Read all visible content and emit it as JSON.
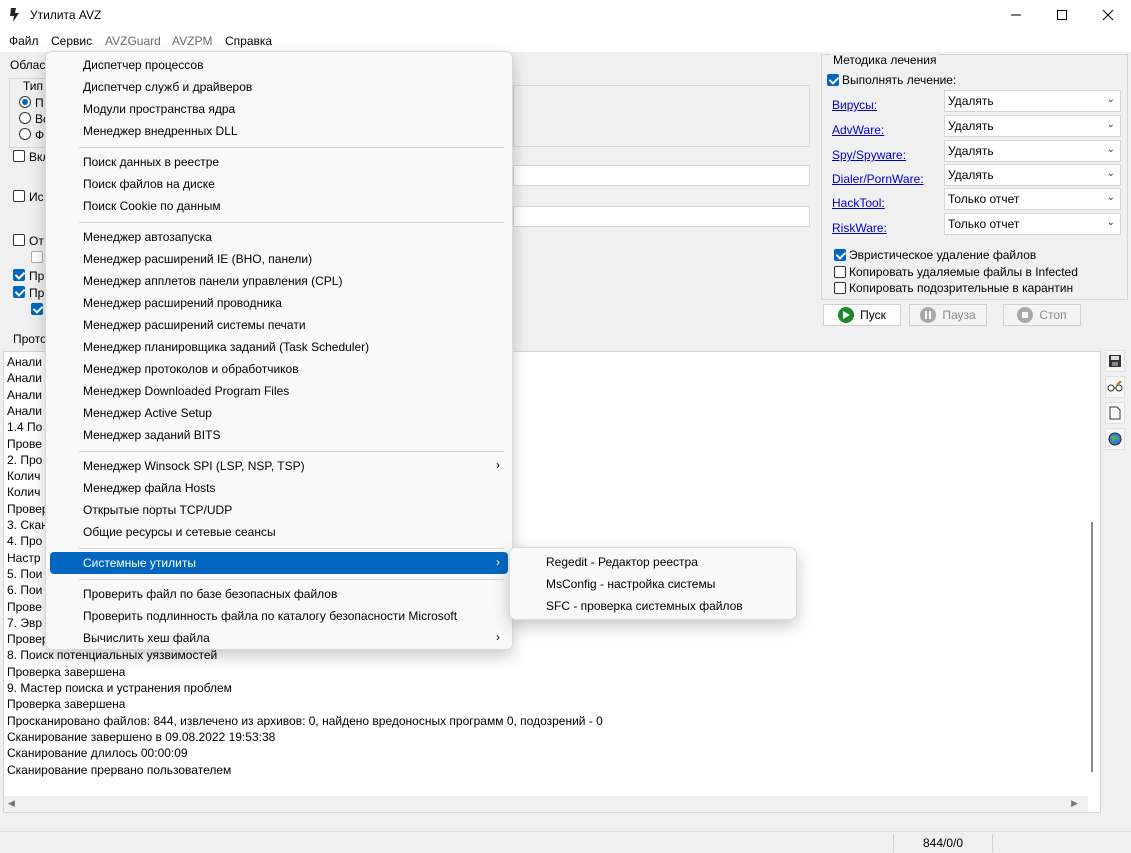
{
  "window": {
    "title": "Утилита AVZ"
  },
  "menubar": {
    "items": [
      {
        "label": "Файл",
        "enabled": true
      },
      {
        "label": "Сервис",
        "enabled": true
      },
      {
        "label": "AVZGuard",
        "enabled": false
      },
      {
        "label": "AVZPM",
        "enabled": false
      },
      {
        "label": "Справка",
        "enabled": true
      }
    ]
  },
  "left_panel": {
    "area_label": "Облас",
    "type_label": "Тип",
    "radios": [
      "П",
      "Вс",
      "Ф"
    ],
    "checks": [
      {
        "label": "Вкл",
        "checked": false
      },
      {
        "label": "Ис",
        "checked": false
      },
      {
        "label": "От",
        "checked": false
      },
      {
        "label": "Пр",
        "checked": true
      },
      {
        "label": "Пр",
        "checked": true
      }
    ]
  },
  "treatment": {
    "title": "Методика лечения",
    "perform_label": "Выполнять лечение:",
    "perform_checked": true,
    "rows": [
      {
        "link": "Вирусы:",
        "value": "Удалять"
      },
      {
        "link": "AdvWare:",
        "value": "Удалять"
      },
      {
        "link": "Spy/Spyware:",
        "value": "Удалять"
      },
      {
        "link": "Dialer/PornWare:",
        "value": "Удалять"
      },
      {
        "link": "HackTool:",
        "value": "Только отчет"
      },
      {
        "link": "RiskWare:",
        "value": "Только отчет"
      }
    ],
    "options": [
      {
        "label": "Эвристическое удаление файлов",
        "checked": true
      },
      {
        "label": "Копировать удаляемые файлы в  Infected",
        "checked": false
      },
      {
        "label": "Копировать подозрительные в  карантин",
        "checked": false
      }
    ]
  },
  "controls": {
    "start": "Пуск",
    "pause": "Пауза",
    "stop": "Стоп"
  },
  "log": {
    "tab_label": "Прото",
    "lines": [
      "Анали",
      " Анали",
      " Анали",
      " Анали",
      "1.4 По",
      " Прове",
      "2. Про",
      " Колич",
      " Колич",
      "Провер",
      "3. Скан",
      "4. Про",
      " Настр",
      "5. Пои",
      "6. Пои",
      " Прове",
      "7. Эвр",
      "Провер",
      "8. Поиск потенциальных уязвимостей",
      "Проверка завершена",
      "9. Мастер поиска и устранения проблем",
      "Проверка завершена",
      "Просканировано файлов: 844, извлечено из архивов: 0, найдено вредоносных программ 0, подозрений - 0",
      "Сканирование завершено в 09.08.2022 19:53:38",
      "Сканирование длилось 00:00:09",
      "Сканирование прервано пользователем"
    ]
  },
  "status": {
    "counter": "844/0/0"
  },
  "service_menu": {
    "groups": [
      [
        "Диспетчер процессов",
        "Диспетчер служб и драйверов",
        "Модули пространства ядра",
        "Менеджер внедренных DLL"
      ],
      [
        "Поиск данных  в реестре",
        "Поиск файлов на диске",
        "Поиск Cookie по данным"
      ],
      [
        "Менеджер автозапуска",
        "Менеджер расширений IE (BHO, панели)",
        "Менеджер апплетов панели управления (CPL)",
        "Менеджер расширений проводника",
        "Менеджер расширений системы печати",
        "Менеджер планировщика заданий (Task Scheduler)",
        "Менеджер протоколов и обработчиков",
        "Менеджер Downloaded Program Files",
        "Менеджер Active Setup",
        "Менеджер заданий BITS"
      ],
      [
        "Менеджер Winsock SPI (LSP, NSP, TSP)",
        "Менеджер файла Hosts",
        "Открытые порты TCP/UDP",
        "Общие ресурсы и сетевые сеансы"
      ],
      [
        "Системные утилиты"
      ],
      [
        "Проверить файл по базе безопасных файлов",
        "Проверить подлинность файла по каталогу безопасности Microsoft",
        "Вычислить хеш файла"
      ]
    ],
    "submenu_items": [
      "Менеджер Winsock SPI (LSP, NSP, TSP)",
      "Системные утилиты",
      "Вычислить хеш файла"
    ],
    "highlighted": "Системные утилиты"
  },
  "system_utils_submenu": [
    "Regedit - Редактор реестра",
    "MsConfig - настройка системы",
    "SFC - проверка системных файлов"
  ]
}
